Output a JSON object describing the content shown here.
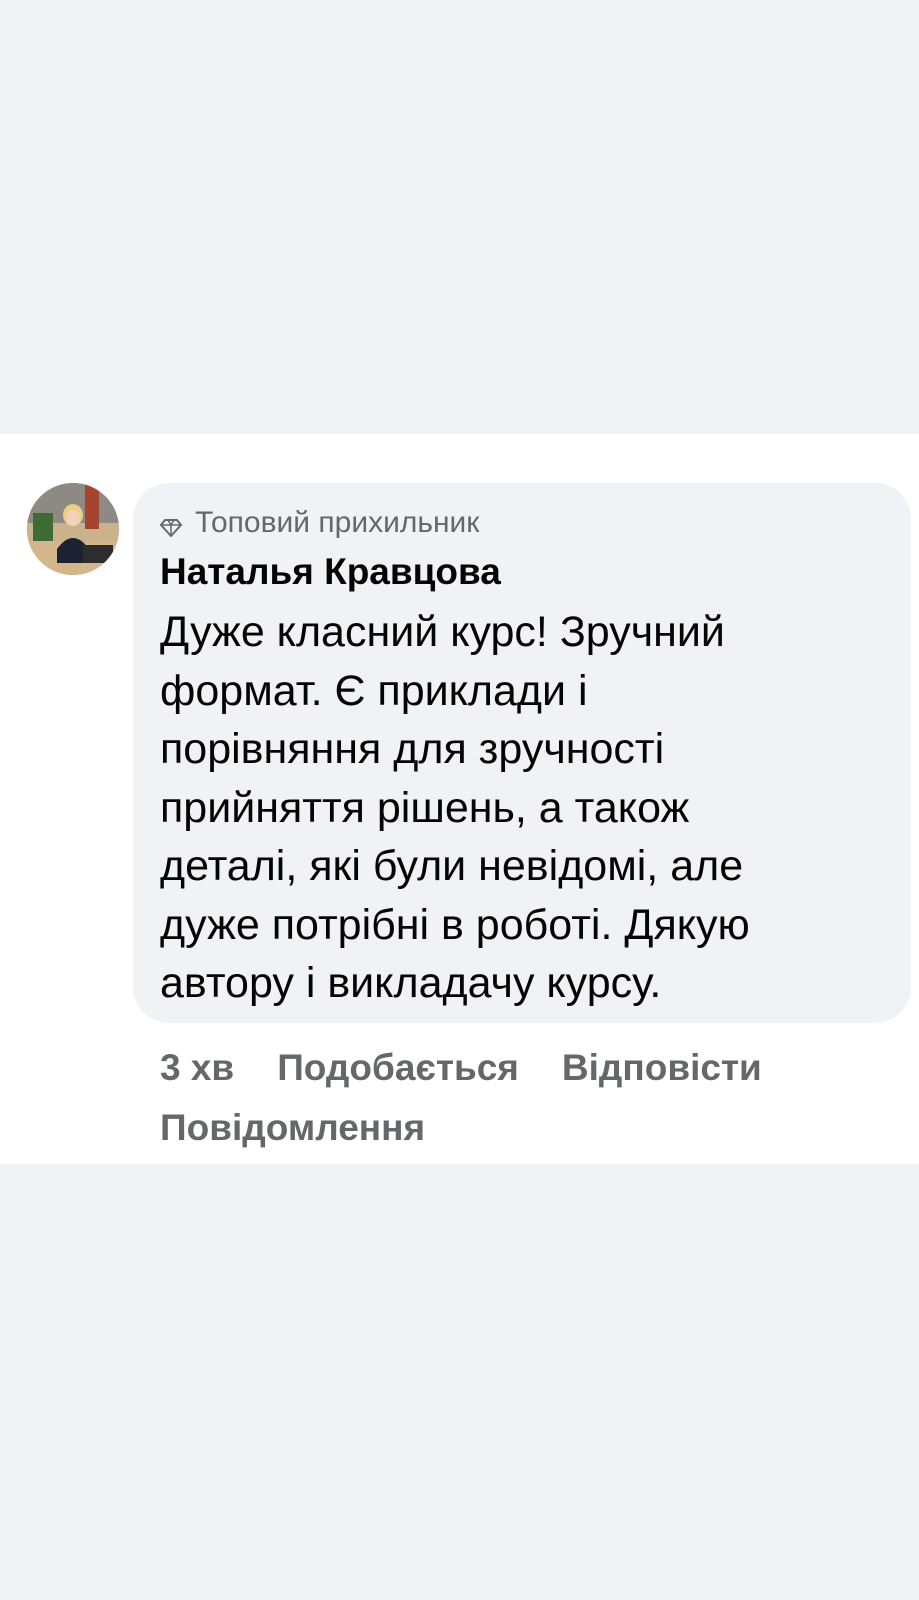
{
  "comment": {
    "badge": "Топовий прихильник",
    "badge_icon": "diamond-icon",
    "author": "Наталья Кравцова",
    "text": "Дуже класний курс! Зручний\nформат. Є приклади і\nпорівняння для зручності\nприйняття рішень, а також\nдеталі, які були невідомі, але\nдуже потрібні в роботі. Дякую\nавтору і викладачу курсу.",
    "time": "3 хв",
    "like_label": "Подобається",
    "reply_label": "Відповісти",
    "message_label": "Повідомлення"
  },
  "colors": {
    "page_background": "#f0f2f5",
    "section_background": "#ffffff",
    "bubble_background": "#f0f2f5",
    "primary_text": "#050505",
    "secondary_text": "#65676b"
  }
}
